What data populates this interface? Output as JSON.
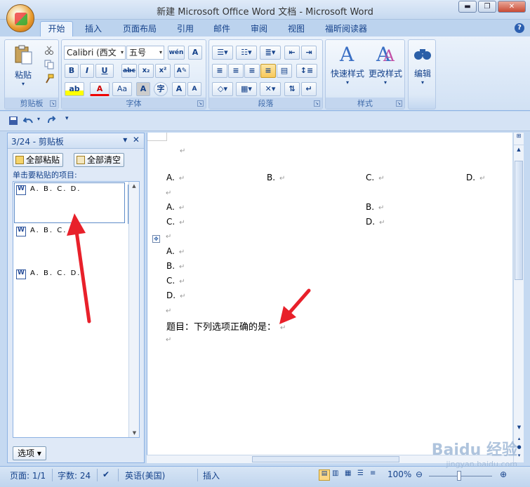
{
  "window": {
    "title": "新建 Microsoft Office Word 文档 - Microsoft Word",
    "minimize": "▬",
    "maximize": "❐",
    "close": "✕"
  },
  "tabs": [
    "开始",
    "插入",
    "页面布局",
    "引用",
    "邮件",
    "审阅",
    "视图",
    "福昕阅读器"
  ],
  "ribbon": {
    "clipboard": {
      "paste": "粘贴",
      "label": "剪贴板"
    },
    "font": {
      "name": "Calibri (西文",
      "size": "五号",
      "wen": "wén",
      "label": "字体",
      "buttons": [
        "B",
        "I",
        "U",
        "abc",
        "x₂",
        "x²",
        "A",
        "Aa",
        "A",
        "字",
        "A",
        "A"
      ]
    },
    "paragraph": {
      "label": "段落"
    },
    "styles": {
      "quick": "快速样式",
      "change": "更改样式",
      "label": "样式"
    },
    "editing": {
      "label": "编辑"
    }
  },
  "clipboard_pane": {
    "title": "3/24 - 剪贴板",
    "paste_all": "全部粘贴",
    "clear_all": "全部清空",
    "hint": "单击要粘贴的项目:",
    "items": [
      "A. B. C. D.",
      "A. B. C. D.",
      "A. B. C. D."
    ],
    "options": "选项 ▾"
  },
  "document": {
    "lines": [
      {
        "cols": [
          "A.",
          "B.",
          "C.",
          "D."
        ]
      },
      {
        "cols": [
          "A.",
          "B."
        ]
      },
      {
        "cols": [
          "C.",
          "D."
        ]
      },
      {
        "cols": [
          "A."
        ]
      },
      {
        "cols": [
          "B."
        ]
      },
      {
        "cols": [
          "C."
        ]
      },
      {
        "cols": [
          "D."
        ]
      },
      {
        "text": "题目：下列选项正确的是："
      }
    ],
    "para_mark": "↵"
  },
  "statusbar": {
    "page": "页面: 1/1",
    "words": "字数: 24",
    "lang": "英语(美国)",
    "mode": "插入",
    "zoom": "100%"
  },
  "watermark": {
    "brand": "Baidu 经验",
    "url": "jingyan.baidu.com"
  },
  "accent": "#e8202a"
}
